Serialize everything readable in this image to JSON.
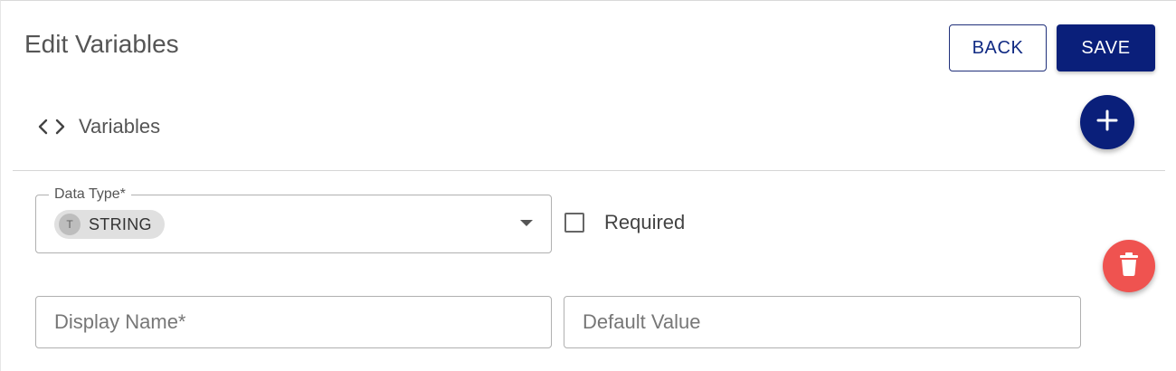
{
  "header": {
    "title": "Edit Variables",
    "back_label": "BACK",
    "save_label": "SAVE"
  },
  "section": {
    "icon": "code-icon",
    "title": "Variables",
    "add_icon": "plus-icon"
  },
  "variable": {
    "data_type": {
      "label": "Data Type*",
      "selected": "STRING",
      "chip_avatar": "T"
    },
    "required": {
      "label": "Required",
      "checked": false
    },
    "display_name": {
      "placeholder": "Display Name*",
      "value": ""
    },
    "default_value": {
      "placeholder": "Default Value",
      "value": ""
    },
    "delete_icon": "trash-icon"
  },
  "colors": {
    "primary": "#0a1f7a",
    "danger": "#ef5350",
    "border": "#b0b0b0",
    "chip": "#e0e0e0"
  }
}
